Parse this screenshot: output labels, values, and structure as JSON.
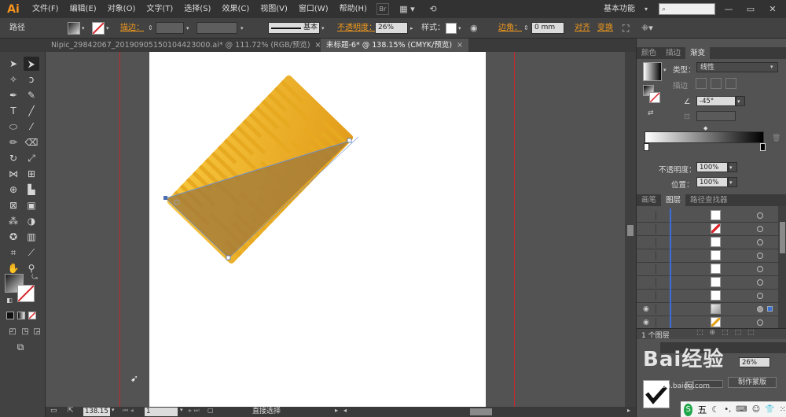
{
  "app": {
    "logo": "Ai"
  },
  "menu": {
    "items": [
      "文件(F)",
      "编辑(E)",
      "对象(O)",
      "文字(T)",
      "选择(S)",
      "效果(C)",
      "视图(V)",
      "窗口(W)",
      "帮助(H)"
    ],
    "br_label": "Br",
    "workspace": "基本功能",
    "search_placeholder": ""
  },
  "control": {
    "selection_type": "路径",
    "stroke_label": "描边：",
    "stroke_profile": "基本",
    "opacity_label": "不透明度：",
    "opacity_value": "26%",
    "style_label": "样式：",
    "corner_label": "边角：",
    "corner_value": "0 mm",
    "align_label": "对齐",
    "transform_label": "变换"
  },
  "tabs": [
    {
      "label": "Nipic_29842067_20190905150104423000.ai* @ 111.72% (RGB/预览)",
      "close": "×",
      "active": false
    },
    {
      "label": "未标题-6* @ 138.15% (CMYK/预览)",
      "close": "×",
      "active": true
    }
  ],
  "status": {
    "zoom": "138.15",
    "page": "1",
    "tool_name": "直接选择"
  },
  "gradient_panel": {
    "tabs": [
      "颜色",
      "描边",
      "渐变"
    ],
    "type_label": "类型：",
    "type_value": "线性",
    "stroke_label": "描边",
    "angle_value": "-45°",
    "opacity_label": "不透明度：",
    "opacity_value": "100%",
    "location_label": "位置：",
    "location_value": "100%"
  },
  "layers_panel": {
    "tabs": [
      "画笔",
      "图层",
      "路径查找器"
    ],
    "footer_count": "1 个图层",
    "row_count": 9
  },
  "bottom_panel": {
    "blend_value": "26%",
    "make_mask": "制作蒙版"
  },
  "watermarks": {
    "brand": "Bai经验",
    "site": "jingyan.baidu.com"
  },
  "taskbar": {
    "ime_label": "五"
  },
  "colors": {
    "ruler_gold_light": "#f5c33a",
    "ruler_gold_dark": "#e3a21c",
    "ruler_overlay": "#a07a3a",
    "guide_red": "#c8272d",
    "accent_orange": "#f29a1c",
    "layer_bar_blue": "#3b6fd6"
  }
}
